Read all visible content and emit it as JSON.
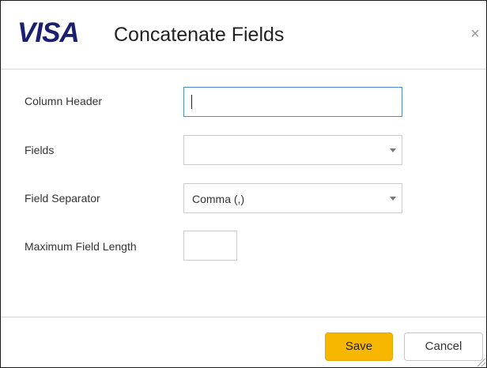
{
  "dialog": {
    "logo_text": "VISA",
    "title": "Concatenate Fields",
    "close_glyph": "×"
  },
  "form": {
    "column_header": {
      "label": "Column Header",
      "value": ""
    },
    "fields": {
      "label": "Fields",
      "value": ""
    },
    "field_separator": {
      "label": "Field Separator",
      "value": "Comma (,)"
    },
    "max_field_length": {
      "label": "Maximum Field Length",
      "value": ""
    }
  },
  "footer": {
    "save_label": "Save",
    "cancel_label": "Cancel"
  },
  "colors": {
    "brand": "#1a1f71",
    "save_button": "#f7b600",
    "focus_border": "#4a90c6"
  },
  "icons": {
    "close": "close-icon",
    "dropdown": "chevron-down-icon",
    "resize": "resize-grip-icon"
  }
}
